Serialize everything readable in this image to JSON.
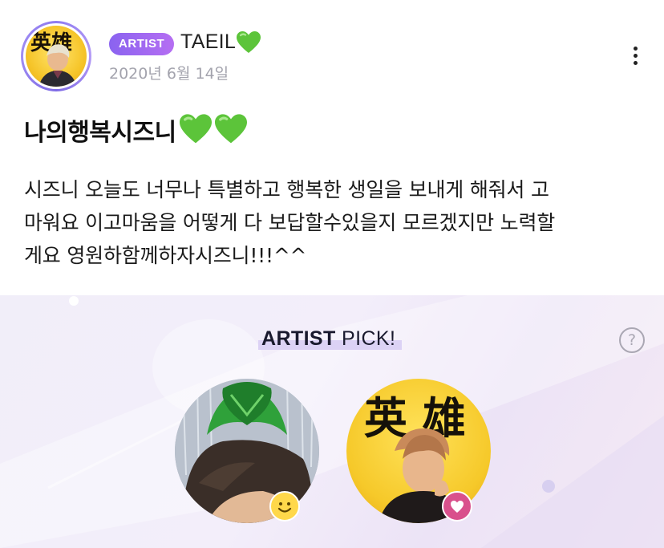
{
  "post": {
    "badge": "ARTIST",
    "artist_name": "TAEIL",
    "date": "2020년 6월 14일",
    "title": "나의행복시즈니",
    "body_lines": [
      "시즈니 오늘도 너무나 특별하고 행복한 생일을 보내게 해줘서 고",
      "마워요 이고마움을 어떻게 다 보답할수있을지 모르겠지만 노력할",
      "게요 영원하함께하자시즈니!!!^^"
    ]
  },
  "avatar": {
    "calligraphy": "英雄"
  },
  "pick": {
    "title_bold": "ARTIST",
    "title_rest": " PICK!",
    "help_symbol": "?",
    "photo_2_calligraphy": "英 雄"
  },
  "colors": {
    "badge_gradient_start": "#8a63f0",
    "badge_gradient_end": "#b56ef2",
    "heart_green": "#5cc43a",
    "date_gray": "#a3a3ad",
    "section_bg": "#f1eef9",
    "reaction_heart": "#d9508c",
    "reaction_smile": "#ffd84a"
  },
  "icons": {
    "more": "more-vertical-icon",
    "help": "question-circle-icon",
    "title_hearts": "green-heart-icon",
    "reaction_1": "smile-face-icon",
    "reaction_2": "heart-icon"
  }
}
